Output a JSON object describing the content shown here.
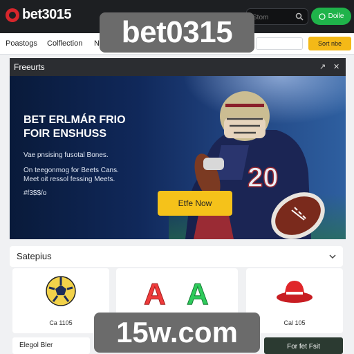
{
  "header": {
    "logo_text": "bet3015",
    "search_placeholder": "Stom",
    "login_label": "Doile"
  },
  "nav": {
    "items": [
      "Poastogs",
      "Colflection",
      "N"
    ],
    "cta_label": "Sort nbe"
  },
  "featured": {
    "title": "Freeurts",
    "headline": [
      "BET ERLMÁR FRIO",
      "FOIR ENSHUSS"
    ],
    "line1": "Vae pnsising fusotal Bones.",
    "line2": "On teegonmog for Beets Cans.",
    "line3": "Meet oit ressol fessing Meets.",
    "line4": "#f3$$/o",
    "cta": "Etfe Now"
  },
  "sports": {
    "title": "Satepius",
    "cards": [
      {
        "label": "Ca 1105",
        "icon": "soccer-ball-icon"
      },
      {
        "label": "",
        "icon": "letter-a-icon"
      },
      {
        "label": "Cal 105",
        "icon": "bucket-hat-icon"
      }
    ]
  },
  "bottom": {
    "left_label": "Elegol Bler",
    "right_label": "For fet Fsit"
  },
  "watermarks": {
    "top": "bet0315",
    "bottom": "15w.com"
  },
  "colors": {
    "header_bg": "#1d1f22",
    "accent_green": "#1fb34a",
    "accent_yellow": "#f4b917",
    "brand_red": "#d7262c"
  }
}
